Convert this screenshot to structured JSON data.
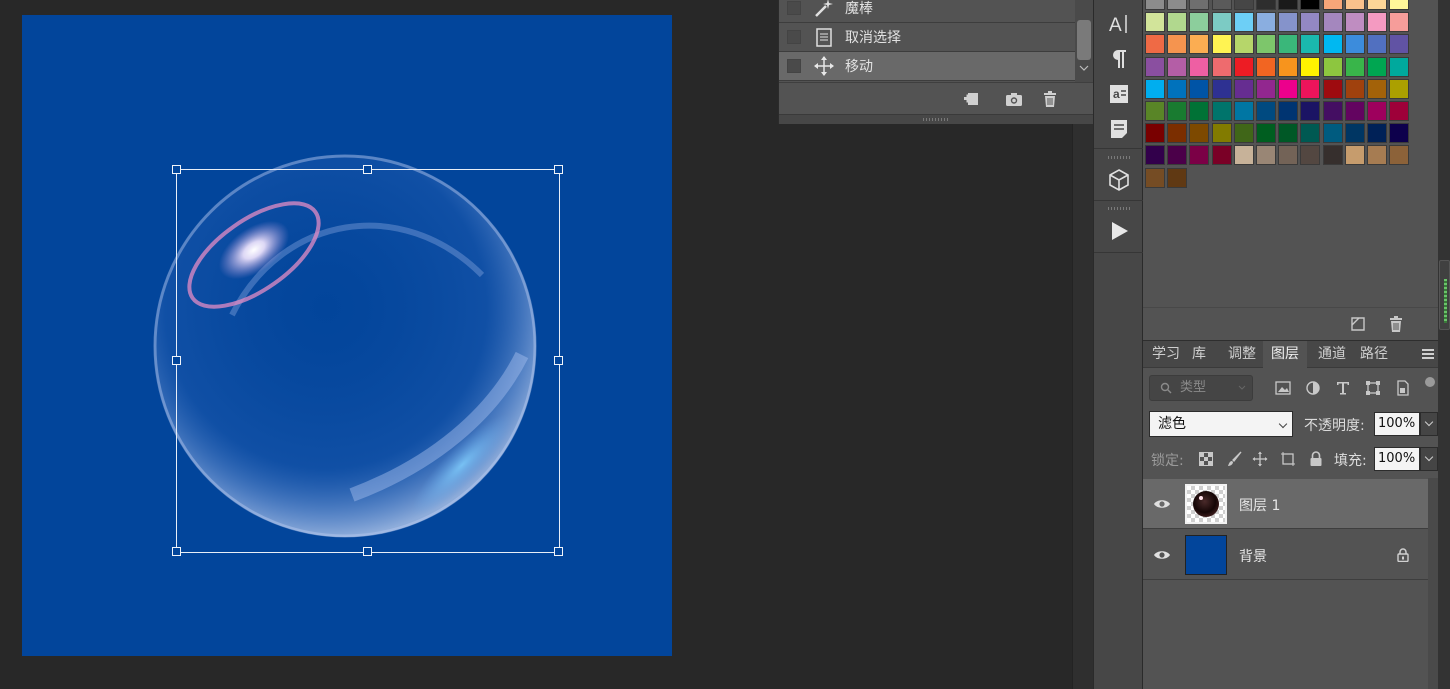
{
  "history": {
    "items": [
      {
        "label": "魔棒",
        "icon": "magic-wand-icon"
      },
      {
        "label": "取消选择",
        "icon": "deselect-icon"
      },
      {
        "label": "移动",
        "icon": "move-icon",
        "active": true
      }
    ]
  },
  "layers": {
    "tabs": [
      {
        "label": "学习",
        "active": false
      },
      {
        "label": "库",
        "active": false
      },
      {
        "label": "调整",
        "active": false
      },
      {
        "label": "图层",
        "active": true
      },
      {
        "label": "通道",
        "active": false
      },
      {
        "label": "路径",
        "active": false
      }
    ],
    "filter_placeholder": "类型",
    "blend_mode": "滤色",
    "opacity_label": "不透明度:",
    "opacity_value": "100%",
    "lock_label": "锁定:",
    "fill_label": "填充:",
    "fill_value": "100%",
    "items": [
      {
        "name": "图层 1",
        "visible": true,
        "active": true,
        "locked": false
      },
      {
        "name": "背景",
        "visible": true,
        "active": false,
        "locked": true
      }
    ]
  },
  "colors": {
    "canvas_bg": "#02459b",
    "panel_bg": "#535353",
    "workspace_bg": "#282828"
  },
  "swatches": [
    [
      "#8c8c8c",
      "#8c8c8c",
      "#6f6f6f",
      "#5a5a5a",
      "#464646",
      "#2e2e2e",
      "#1a1a1a",
      "#000000",
      "#f7a679",
      "#f9c18c",
      "#fdd597",
      "#fff799"
    ],
    [
      "#d2e49a",
      "#b1d88e",
      "#8cce9c",
      "#7ccbc4",
      "#6dcff6",
      "#8aaee0",
      "#8593cb",
      "#9388c3",
      "#a487be",
      "#bf8dc1",
      "#f49ac1",
      "#f69d9a"
    ],
    [
      "#ef6a45",
      "#f5944f",
      "#fbad52",
      "#fff352",
      "#b6d66a",
      "#7dc66b",
      "#3ab77a",
      "#1ab8ae",
      "#00b8f1",
      "#3c8cdc",
      "#5170c0",
      "#6153a4"
    ],
    [
      "#8a4fa0",
      "#b45ea6",
      "#ee5fa3",
      "#ee6b6e",
      "#ed1c24",
      "#f26522",
      "#f7941d",
      "#fff200",
      "#8dc63f",
      "#39b54a",
      "#00a651",
      "#00a99d"
    ],
    [
      "#00aeef",
      "#0072bc",
      "#0054a6",
      "#2e3192",
      "#662d91",
      "#92278f",
      "#ec008c",
      "#ed145b",
      "#9e0b0f",
      "#a0410d",
      "#a36209",
      "#aba000"
    ],
    [
      "#598527",
      "#197b30",
      "#007236",
      "#00746b",
      "#0076a3",
      "#004a80",
      "#003471",
      "#1b1464",
      "#440e62",
      "#630460",
      "#9e005d",
      "#9e0039"
    ],
    [
      "#790000",
      "#7b2e00",
      "#7d4900",
      "#827b00",
      "#406618",
      "#005e20",
      "#005826",
      "#005952",
      "#005b7f",
      "#003663",
      "#002157",
      "#0d004c"
    ],
    [
      "#32004b",
      "#4b0049",
      "#7b0046",
      "#7a0026",
      "#c7b299",
      "#998675",
      "#736357",
      "#534741",
      "#362f2d",
      "#c69c6d",
      "#a67c52",
      "#8c6239"
    ],
    [
      "#754c24",
      "#603913"
    ]
  ]
}
